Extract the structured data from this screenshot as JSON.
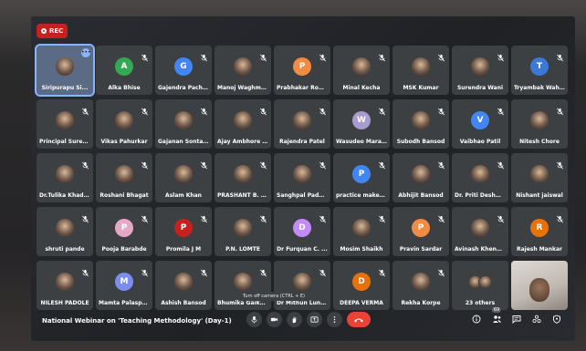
{
  "recording": {
    "label": "REC"
  },
  "participants": [
    {
      "name": "Siripurapu Si...",
      "initial": "",
      "color": "",
      "type": "photo",
      "active": true
    },
    {
      "name": "Alka Bhise",
      "initial": "A",
      "color": "#34a853",
      "type": "initial"
    },
    {
      "name": "Gajendra Pachi...",
      "initial": "G",
      "color": "#4285f4",
      "type": "initial"
    },
    {
      "name": "Manoj Waghma...",
      "initial": "",
      "color": "",
      "type": "photo"
    },
    {
      "name": "Prabhakar Roh...",
      "initial": "P",
      "color": "#f28b44",
      "type": "initial"
    },
    {
      "name": "Minal Kecha",
      "initial": "",
      "color": "",
      "type": "photo"
    },
    {
      "name": "MSK Kumar",
      "initial": "",
      "color": "",
      "type": "photo"
    },
    {
      "name": "Surendra Wani",
      "initial": "",
      "color": "",
      "type": "photo"
    },
    {
      "name": "Tryambak Wah...",
      "initial": "T",
      "color": "#3c78d8",
      "type": "initial"
    },
    {
      "name": "Principal Sures...",
      "initial": "",
      "color": "",
      "type": "photo"
    },
    {
      "name": "Vikas Pahurkar",
      "initial": "",
      "color": "",
      "type": "photo"
    },
    {
      "name": "Gajanan Sontape",
      "initial": "",
      "color": "",
      "type": "photo"
    },
    {
      "name": "Ajay Ambhore ...",
      "initial": "",
      "color": "",
      "type": "photo"
    },
    {
      "name": "Rajendra Patel",
      "initial": "",
      "color": "",
      "type": "photo"
    },
    {
      "name": "Wasudeo Mara...",
      "initial": "W",
      "color": "#a79bd0",
      "type": "initial"
    },
    {
      "name": "Subodh Bansod",
      "initial": "",
      "color": "",
      "type": "photo"
    },
    {
      "name": "Vaibhao Patil",
      "initial": "V",
      "color": "#4285f4",
      "type": "initial"
    },
    {
      "name": "Nitesh Chore",
      "initial": "",
      "color": "",
      "type": "photo"
    },
    {
      "name": "Dr.Tulika Khades",
      "initial": "",
      "color": "",
      "type": "photo"
    },
    {
      "name": "Roshani Bhagat",
      "initial": "",
      "color": "",
      "type": "photo"
    },
    {
      "name": "Aslam Khan",
      "initial": "",
      "color": "",
      "type": "photo"
    },
    {
      "name": "PRASHANT B. K...",
      "initial": "",
      "color": "",
      "type": "photo"
    },
    {
      "name": "Sanghpal Padh...",
      "initial": "",
      "color": "",
      "type": "photo"
    },
    {
      "name": "practice makes...",
      "initial": "P",
      "color": "#4285f4",
      "type": "initial"
    },
    {
      "name": "Abhijit Bansod",
      "initial": "",
      "color": "",
      "type": "photo"
    },
    {
      "name": "Dr. Priti Deshm...",
      "initial": "",
      "color": "",
      "type": "photo"
    },
    {
      "name": "Nishant jaiswal",
      "initial": "",
      "color": "",
      "type": "photo"
    },
    {
      "name": "shruti pande",
      "initial": "",
      "color": "",
      "type": "photo"
    },
    {
      "name": "Pooja Barabde",
      "initial": "P",
      "color": "#e6a7c8",
      "type": "initial"
    },
    {
      "name": "Promila J M",
      "initial": "P",
      "color": "#c5221f",
      "type": "initial"
    },
    {
      "name": "P.N. LOMTE",
      "initial": "",
      "color": "",
      "type": "photo"
    },
    {
      "name": "Dr Furquan C. ...",
      "initial": "D",
      "color": "#c58af9",
      "type": "initial"
    },
    {
      "name": "Mosim Shaikh",
      "initial": "",
      "color": "",
      "type": "photo"
    },
    {
      "name": "Pravin Sardar",
      "initial": "P",
      "color": "#f28b44",
      "type": "initial"
    },
    {
      "name": "Avinash Khend...",
      "initial": "",
      "color": "",
      "type": "photo"
    },
    {
      "name": "Rajesh Mankar",
      "initial": "R",
      "color": "#e8710a",
      "type": "initial"
    },
    {
      "name": "NILESH PADOLE",
      "initial": "",
      "color": "",
      "type": "photo"
    },
    {
      "name": "Mamta Palaspa...",
      "initial": "M",
      "color": "#7b8ef0",
      "type": "initial"
    },
    {
      "name": "Ashish Bansod",
      "initial": "",
      "color": "",
      "type": "photo"
    },
    {
      "name": "Bhumika Gaikw...",
      "initial": "",
      "color": "",
      "type": "photo"
    },
    {
      "name": "Dr Mithun Lunge",
      "initial": "",
      "color": "",
      "type": "photo"
    },
    {
      "name": "DEEPA VERMA",
      "initial": "D",
      "color": "#e8710a",
      "type": "initial"
    },
    {
      "name": "Rekha Korpe",
      "initial": "",
      "color": "",
      "type": "photo"
    },
    {
      "name": "23 others",
      "initial": "",
      "color": "",
      "type": "others"
    },
    {
      "name": "",
      "initial": "",
      "color": "",
      "type": "self"
    }
  ],
  "meeting": {
    "title": "National Webinar on 'Teaching Methodology' (Day-1)"
  },
  "tooltip": {
    "text": "Turn off camera (CTRL + E)"
  },
  "people_count": "69"
}
